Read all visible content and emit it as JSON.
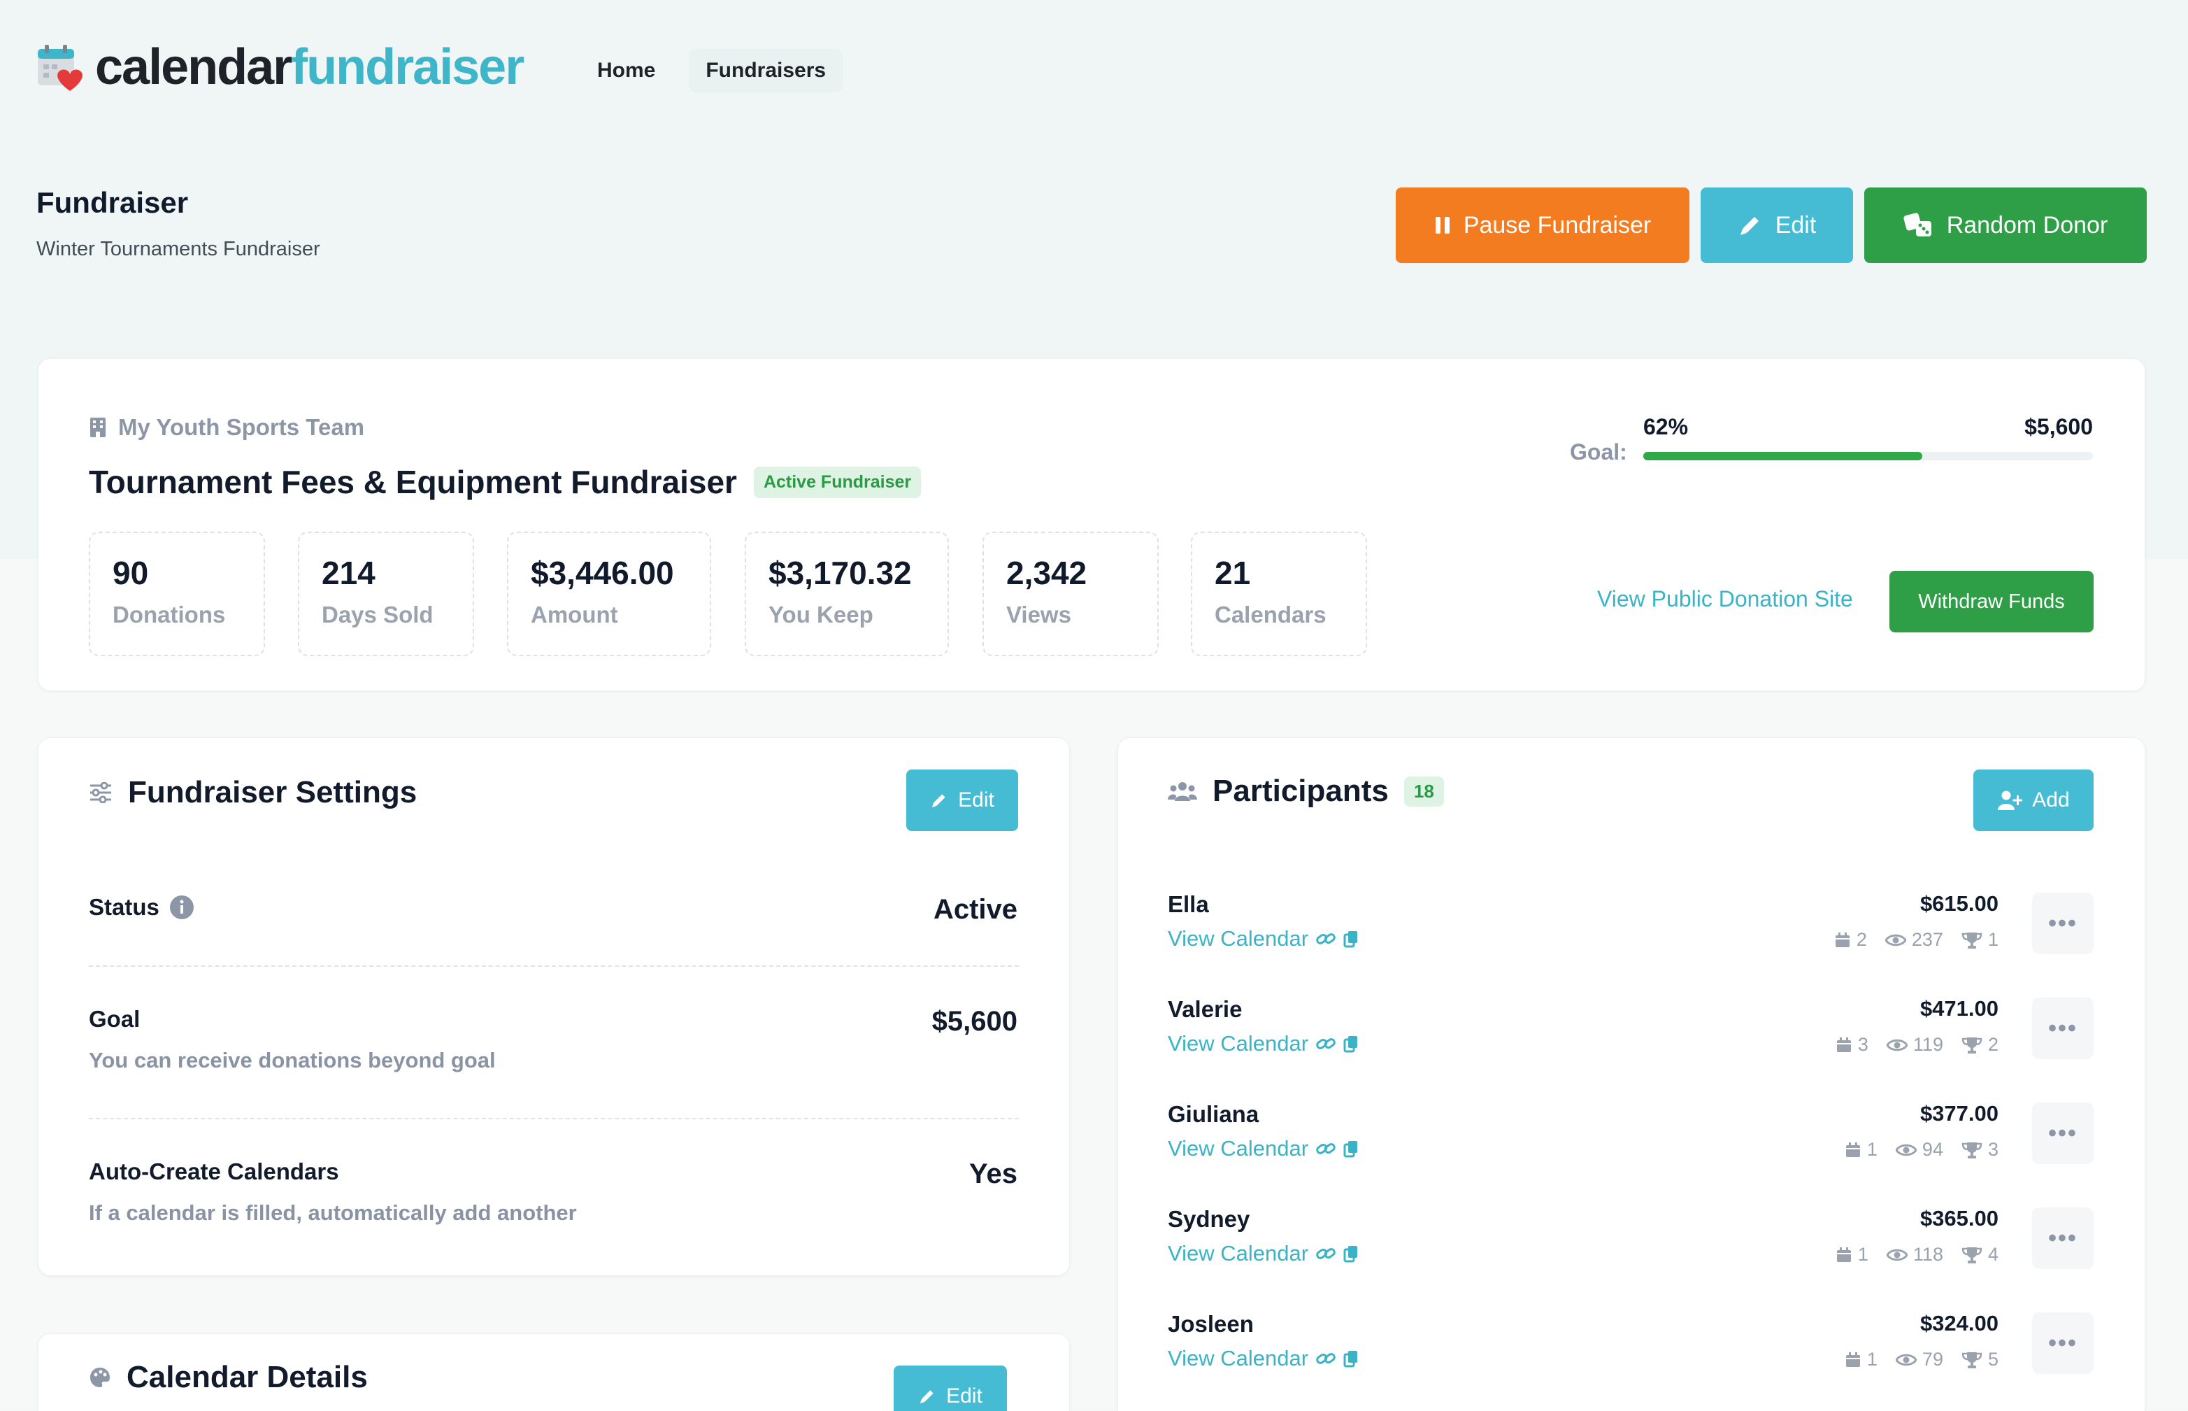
{
  "header": {
    "logo_part1": "calendar",
    "logo_part2": "fundraiser",
    "nav": [
      {
        "label": "Home",
        "active": false
      },
      {
        "label": "Fundraisers",
        "active": true
      }
    ]
  },
  "page": {
    "title": "Fundraiser",
    "subtitle": "Winter Tournaments Fundraiser",
    "actions": {
      "pause": "Pause Fundraiser",
      "edit": "Edit",
      "random": "Random Donor"
    }
  },
  "summary": {
    "organization": "My Youth Sports Team",
    "title": "Tournament Fees & Equipment Fundraiser",
    "status_badge": "Active Fundraiser",
    "stats": [
      {
        "value": "90",
        "label": "Donations"
      },
      {
        "value": "214",
        "label": "Days Sold"
      },
      {
        "value": "$3,446.00",
        "label": "Amount"
      },
      {
        "value": "$3,170.32",
        "label": "You Keep"
      },
      {
        "value": "2,342",
        "label": "Views"
      },
      {
        "value": "21",
        "label": "Calendars"
      }
    ],
    "goal": {
      "label": "Goal:",
      "percent_text": "62%",
      "percent": 62,
      "amount": "$5,600"
    },
    "public_link": "View Public Donation Site",
    "withdraw": "Withdraw Funds"
  },
  "settings": {
    "title": "Fundraiser Settings",
    "edit": "Edit",
    "rows": [
      {
        "label": "Status",
        "sub": "",
        "value": "Active"
      },
      {
        "label": "Goal",
        "sub": "You can receive donations beyond goal",
        "value": "$5,600"
      },
      {
        "label": "Auto-Create Calendars",
        "sub": "If a calendar is filled, automatically add another",
        "value": "Yes"
      }
    ]
  },
  "calendar_details": {
    "title": "Calendar Details",
    "edit": "Edit"
  },
  "participants": {
    "title": "Participants",
    "count": "18",
    "add": "Add",
    "link_label": "View Calendar",
    "items": [
      {
        "name": "Ella",
        "amount": "$615.00",
        "calendars": "2",
        "views": "237",
        "rank": "1"
      },
      {
        "name": "Valerie",
        "amount": "$471.00",
        "calendars": "3",
        "views": "119",
        "rank": "2"
      },
      {
        "name": "Giuliana",
        "amount": "$377.00",
        "calendars": "1",
        "views": "94",
        "rank": "3"
      },
      {
        "name": "Sydney",
        "amount": "$365.00",
        "calendars": "1",
        "views": "118",
        "rank": "4"
      },
      {
        "name": "Josleen",
        "amount": "$324.00",
        "calendars": "1",
        "views": "79",
        "rank": "5"
      }
    ]
  },
  "colors": {
    "brand_cyan": "#45bcd4",
    "brand_orange": "#f47c20",
    "brand_green": "#2e9e47"
  }
}
